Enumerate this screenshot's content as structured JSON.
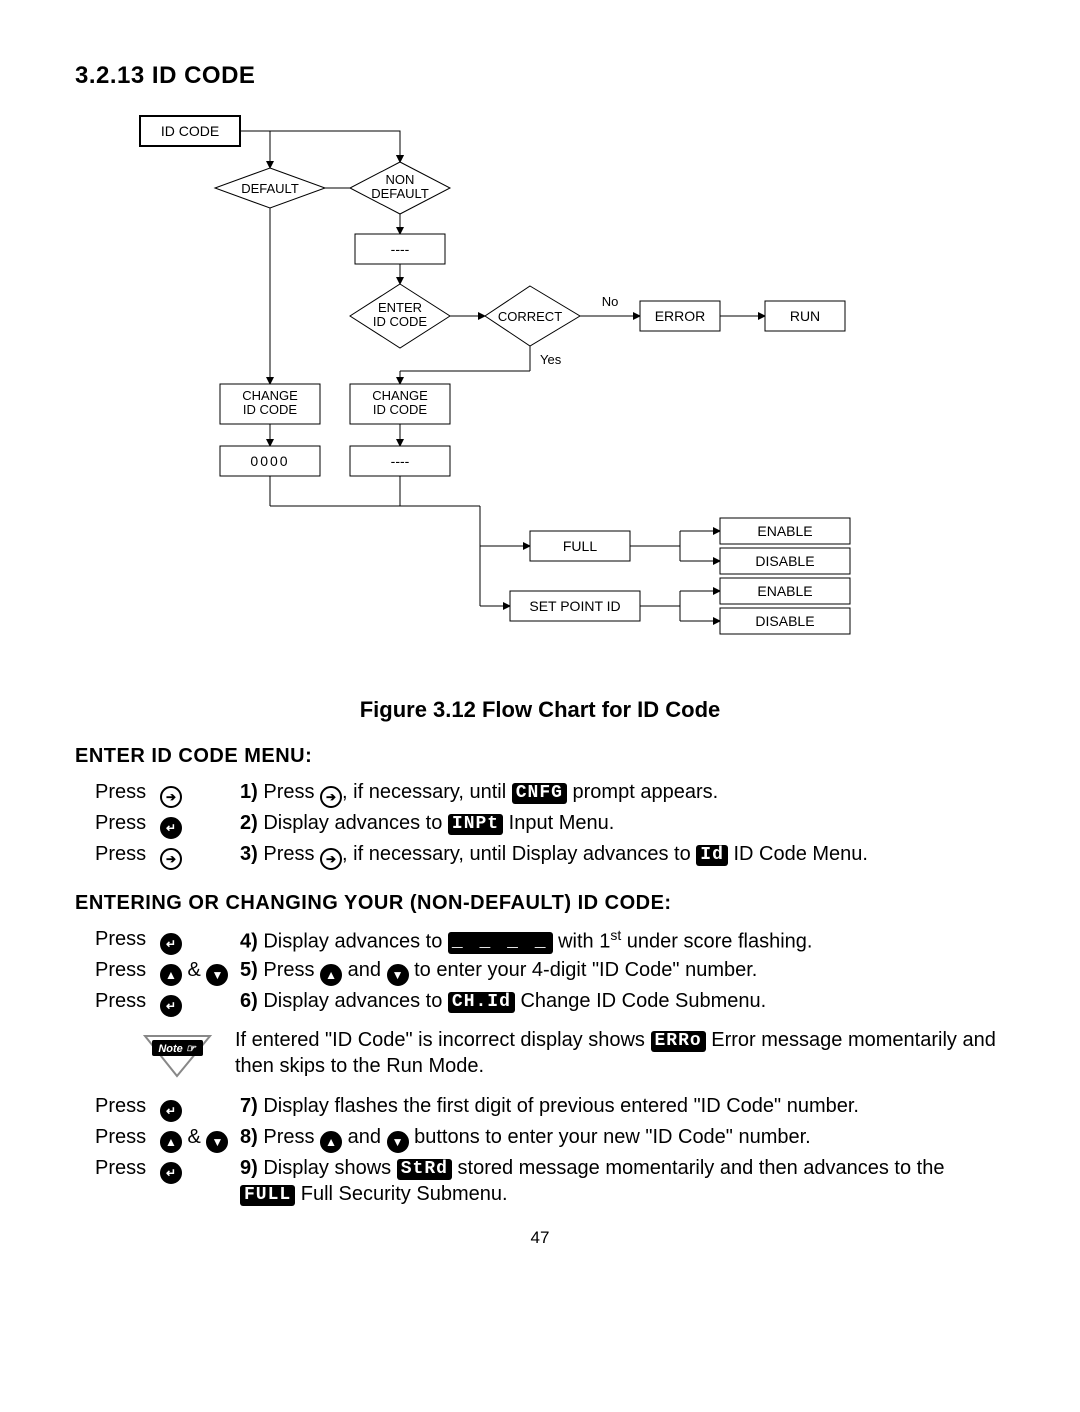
{
  "section": {
    "title": "3.2.13 ID CODE"
  },
  "figure": {
    "caption": "Figure 3.12 Flow Chart for ID Code"
  },
  "flow": {
    "idcode": "ID CODE",
    "default": "DEFAULT",
    "nondefault1": "NON",
    "nondefault2": "DEFAULT",
    "blank": "----",
    "enter1": "ENTER",
    "enter2": "ID CODE",
    "correct": "CORRECT",
    "no": "No",
    "yes": "Yes",
    "error": "ERROR",
    "run": "RUN",
    "change1": "CHANGE",
    "change2": "ID CODE",
    "zeros": "0000",
    "full": "FULL",
    "setpoint": "SET POINT ID",
    "enable": "ENABLE",
    "disable": "DISABLE"
  },
  "sub1": {
    "heading": "ENTER ID CODE MENU:"
  },
  "press": "Press",
  "amp": " & ",
  "step1": {
    "n": "1)",
    "a": " Press ",
    "b": ", if necessary, until ",
    "lcd": "CNFG",
    "c": " prompt appears."
  },
  "step2": {
    "n": "2)",
    "a": " Display advances to ",
    "lcd": "INPt",
    "c": " Input Menu."
  },
  "step3": {
    "n": "3)",
    "a": " Press ",
    "b": ", if necessary, until Display advances to ",
    "lcd": "Id",
    "c": " ID Code Menu."
  },
  "sub2": {
    "heading": "ENTERING OR CHANGING YOUR (NON-DEFAULT) ID CODE:"
  },
  "step4": {
    "n": "4)",
    "a": " Display advances to ",
    "lcd": "_ _ _ _",
    "b": " with 1",
    "sup": "st",
    "c": " under score flashing."
  },
  "step5": {
    "n": "5)",
    "a": " Press ",
    "b": " and ",
    "c": " to enter your 4-digit \"ID Code\" number."
  },
  "step6": {
    "n": "6)",
    "a": " Display advances to ",
    "lcd": "CH.Id",
    "c": " Change ID Code Submenu."
  },
  "note": {
    "label": "Note ☞",
    "a": "If  entered \"ID Code\" is incorrect display shows ",
    "lcd": "ERRo",
    "b": "  Error message momentarily and then skips to the Run Mode."
  },
  "step7": {
    "n": "7)",
    "a": " Display flashes the first digit of previous entered \"ID Code\" number."
  },
  "step8": {
    "n": "8)",
    "a": " Press ",
    "b": " and ",
    "c": " buttons to enter your new \"ID Code\" number."
  },
  "step9": {
    "n": "9)",
    "a": " Display shows ",
    "lcd1": "StRd",
    "b": " stored message momentarily and then advances to the ",
    "lcd2": "FULL",
    "c": " Full Security Submenu."
  },
  "pagenum": "47"
}
